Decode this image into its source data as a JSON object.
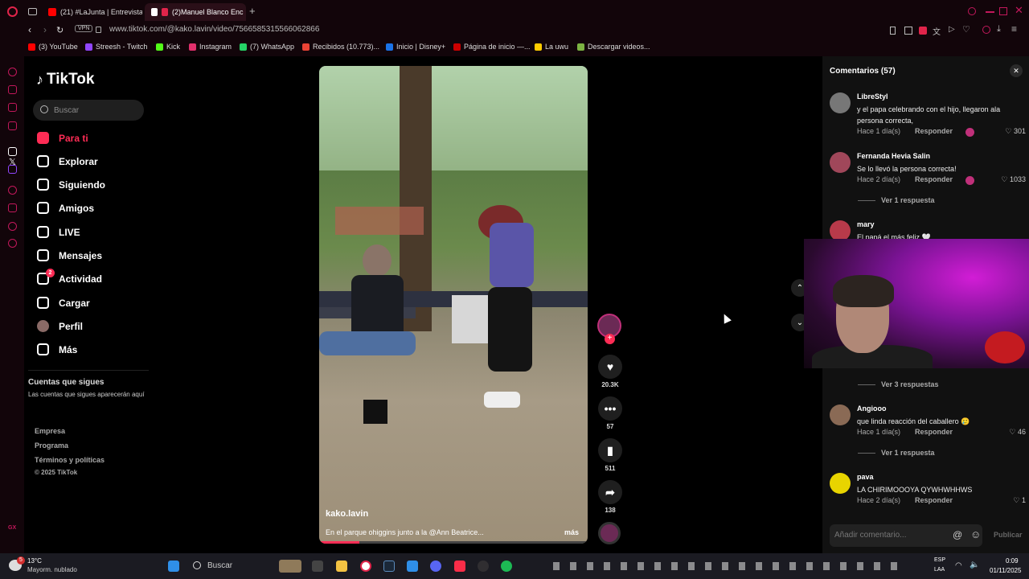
{
  "browser": {
    "tabs": [
      {
        "label": "(21) #LaJunta | Entrevista"
      },
      {
        "label": "(2)Manuel Blanco Enc"
      }
    ],
    "url": "www.tiktok.com/@kako.lavin/video/7566585315566062866",
    "vpn_label": "VPN",
    "bookmarks": [
      {
        "label": "(3) YouTube",
        "color": "#ff0000"
      },
      {
        "label": "Streesh - Twitch",
        "color": "#9146ff"
      },
      {
        "label": "Kick",
        "color": "#53fc18"
      },
      {
        "label": "Instagram",
        "color": "#e1306c"
      },
      {
        "label": "(7) WhatsApp",
        "color": "#25d366"
      },
      {
        "label": "Recibidos (10.773)...",
        "color": "#ea4335"
      },
      {
        "label": "Inicio | Disney+",
        "color": "#1a73e8"
      },
      {
        "label": "Página de inicio —...",
        "color": "#cc0000"
      },
      {
        "label": "La uwu",
        "color": "#ffcc00"
      },
      {
        "label": "Descargar videos...",
        "color": "#7cb342"
      }
    ]
  },
  "sidebar": {
    "logo": "TikTok",
    "search_placeholder": "Buscar",
    "nav": [
      {
        "label": "Para ti",
        "icon": "home-icon",
        "active": true
      },
      {
        "label": "Explorar",
        "icon": "compass-icon"
      },
      {
        "label": "Siguiendo",
        "icon": "user-follow-icon"
      },
      {
        "label": "Amigos",
        "icon": "friends-icon"
      },
      {
        "label": "LIVE",
        "icon": "live-icon"
      },
      {
        "label": "Mensajes",
        "icon": "send-icon"
      },
      {
        "label": "Actividad",
        "icon": "activity-icon",
        "badge": "2"
      },
      {
        "label": "Cargar",
        "icon": "upload-icon"
      },
      {
        "label": "Perfil",
        "icon": "avatar"
      },
      {
        "label": "Más",
        "icon": "more-icon"
      }
    ],
    "following_title": "Cuentas que sigues",
    "following_subtitle": "Las cuentas que sigues aparecerán aquí",
    "footer": [
      "Empresa",
      "Programa",
      "Términos y políticas",
      "© 2025 TikTok"
    ]
  },
  "video": {
    "author": "kako.lavin",
    "caption": "En el parque ohiggins junto a la @Ann Beatrice...",
    "more": "más",
    "progress": 0.15
  },
  "actions": {
    "likes": "20.3K",
    "comments": "57",
    "saves": "511",
    "shares": "138"
  },
  "comments": {
    "title": "Comentarios (57)",
    "items": [
      {
        "user": "LibreStyl",
        "text": "y el papa celebrando con el hijo, llegaron ala persona correcta,",
        "time": "Hace 1 día(s)",
        "reply": "Responder",
        "likes": "301",
        "avatar_color": "#777"
      },
      {
        "user": "Fernanda Hevia Salin",
        "text": "Se lo llevó la persona correcta!",
        "time": "Hace 2 día(s)",
        "reply": "Responder",
        "likes": "1033",
        "avatar_color": "#a0475a",
        "view_replies": "Ver 1 respuesta"
      },
      {
        "user": "mary",
        "text": "El papá el más feliz 🤍",
        "avatar_color": "#b83a4a"
      },
      {
        "view_replies": "Ver 3 respuestas"
      },
      {
        "user": "Angiooo",
        "text": "que linda reacción del caballero 🥲",
        "time": "Hace 1 día(s)",
        "reply": "Responder",
        "likes": "46",
        "avatar_color": "#8a6a55",
        "view_replies": "Ver 1 respuesta"
      },
      {
        "user": "pava",
        "text": "LA CHIRIMOOOYA QYWHWHHWS",
        "time": "Hace 2 día(s)",
        "reply": "Responder",
        "likes": "1",
        "avatar_color": "#e8d400"
      }
    ],
    "add_placeholder": "Añadir comentario...",
    "publish": "Publicar"
  },
  "taskbar": {
    "weather_temp": "13°C",
    "weather_desc": "Mayorm. nublado",
    "weather_badge": "5",
    "search": "Buscar",
    "lang": "ESP",
    "lang2": "LAA",
    "time": "0:09",
    "date": "01/11/2025"
  }
}
